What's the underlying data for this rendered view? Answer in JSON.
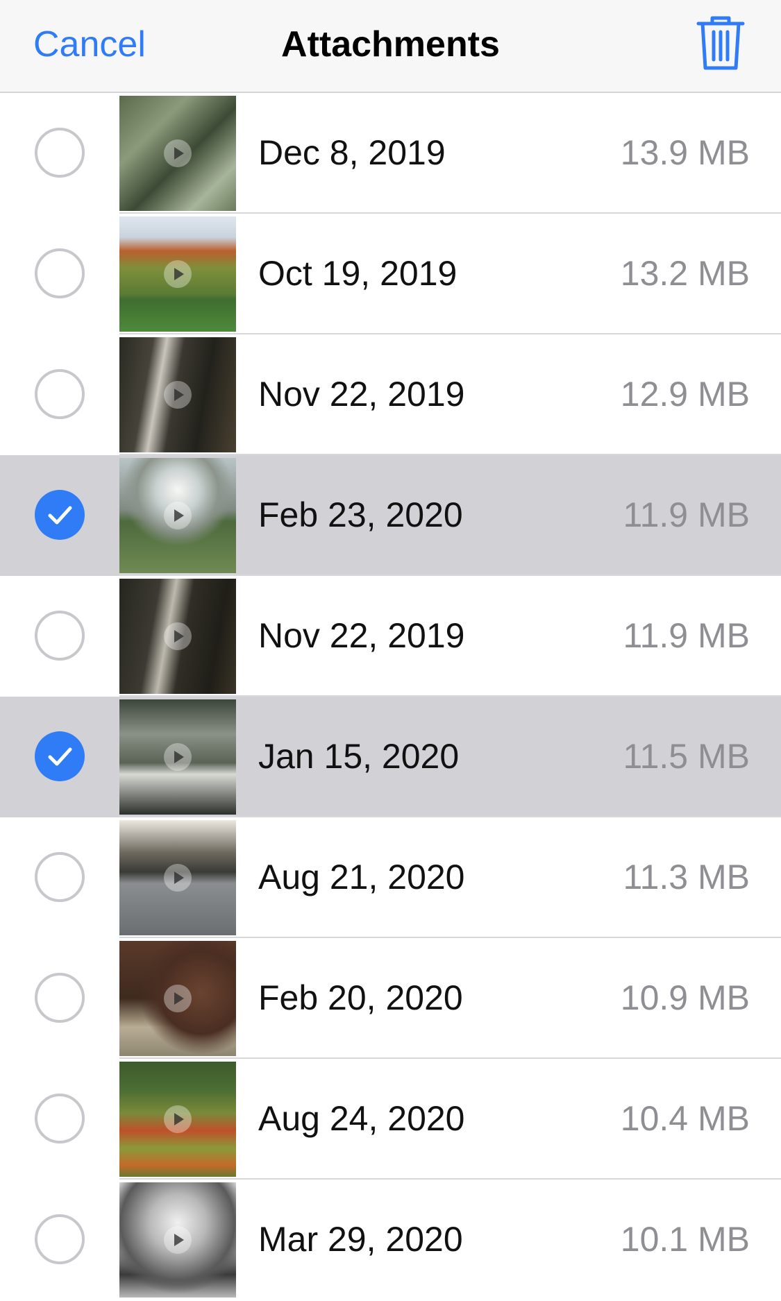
{
  "nav": {
    "cancel_label": "Cancel",
    "title": "Attachments",
    "trash_icon": "trash-icon"
  },
  "colors": {
    "accent": "#2f7cf6",
    "selected_row": "#d1d1d6",
    "secondary_text": "#8e8e93"
  },
  "attachments": [
    {
      "date": "Dec 8, 2019",
      "size": "13.9 MB",
      "selected": false,
      "thumb": "video-thumbnail"
    },
    {
      "date": "Oct 19, 2019",
      "size": "13.2 MB",
      "selected": false,
      "thumb": "video-thumbnail"
    },
    {
      "date": "Nov 22, 2019",
      "size": "12.9 MB",
      "selected": false,
      "thumb": "video-thumbnail"
    },
    {
      "date": "Feb 23, 2020",
      "size": "11.9 MB",
      "selected": true,
      "thumb": "video-thumbnail"
    },
    {
      "date": "Nov 22, 2019",
      "size": "11.9 MB",
      "selected": false,
      "thumb": "video-thumbnail"
    },
    {
      "date": "Jan 15, 2020",
      "size": "11.5 MB",
      "selected": true,
      "thumb": "video-thumbnail"
    },
    {
      "date": "Aug 21, 2020",
      "size": "11.3 MB",
      "selected": false,
      "thumb": "video-thumbnail"
    },
    {
      "date": "Feb 20, 2020",
      "size": "10.9 MB",
      "selected": false,
      "thumb": "video-thumbnail"
    },
    {
      "date": "Aug 24, 2020",
      "size": "10.4 MB",
      "selected": false,
      "thumb": "video-thumbnail"
    },
    {
      "date": "Mar 29, 2020",
      "size": "10.1 MB",
      "selected": false,
      "thumb": "video-thumbnail"
    }
  ]
}
